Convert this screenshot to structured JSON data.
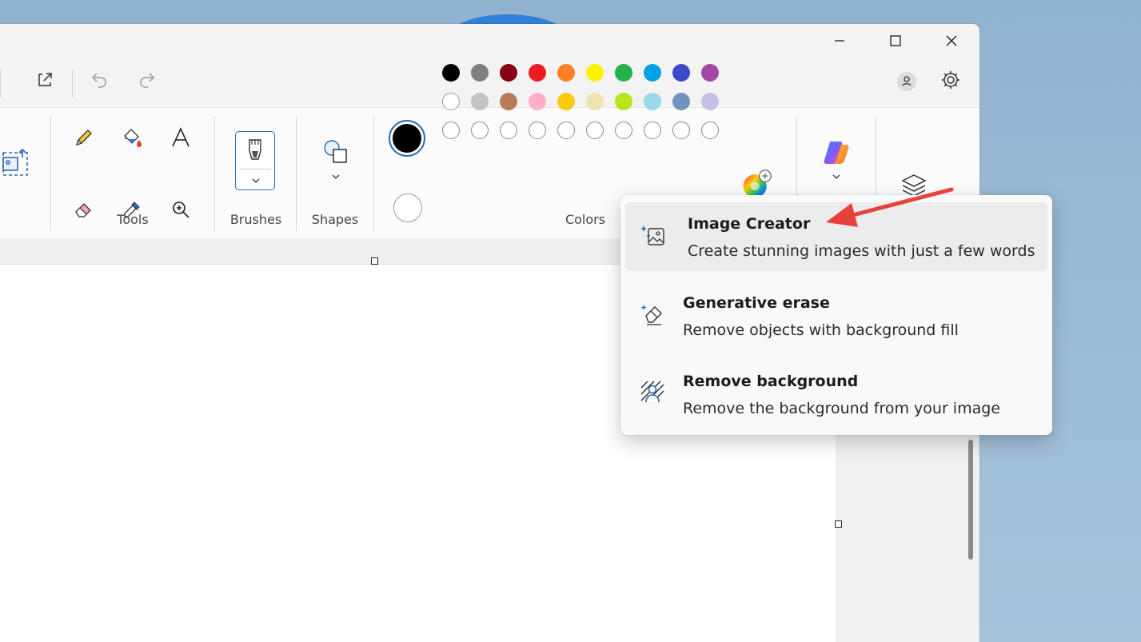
{
  "window": {
    "controls": {
      "minimize": "minimize",
      "maximize": "maximize",
      "close": "close"
    }
  },
  "toolbar": {
    "icons": [
      "share-icon",
      "undo-icon",
      "redo-icon",
      "account-icon",
      "settings-icon"
    ]
  },
  "ribbon": {
    "groups": {
      "tools": "Tools",
      "brushes": "Brushes",
      "shapes": "Shapes",
      "colors": "Colors"
    },
    "colors": {
      "primary": "#000000",
      "secondary": "#ffffff",
      "row1": [
        "#000000",
        "#7f7f7f",
        "#880015",
        "#ed1c24",
        "#ff7f27",
        "#fff200",
        "#22b14c",
        "#00a2e8",
        "#3f48cc",
        "#a349a4"
      ],
      "row2": [
        "#ffffff",
        "#c3c3c3",
        "#b97a57",
        "#ffaec9",
        "#ffc90e",
        "#efe4b0",
        "#b5e61d",
        "#99d9ea",
        "#7092be",
        "#c8bfe7"
      ],
      "row3_empty_count": 10
    }
  },
  "ai_menu": {
    "items": [
      {
        "title": "Image Creator",
        "description": "Create stunning images with just a few words",
        "icon": "image-creator-icon"
      },
      {
        "title": "Generative erase",
        "description": "Remove objects with background fill",
        "icon": "generative-erase-icon"
      },
      {
        "title": "Remove background",
        "description": "Remove the background from your image",
        "icon": "remove-background-icon"
      }
    ]
  },
  "annotation": {
    "arrow_color": "#e8403a"
  }
}
